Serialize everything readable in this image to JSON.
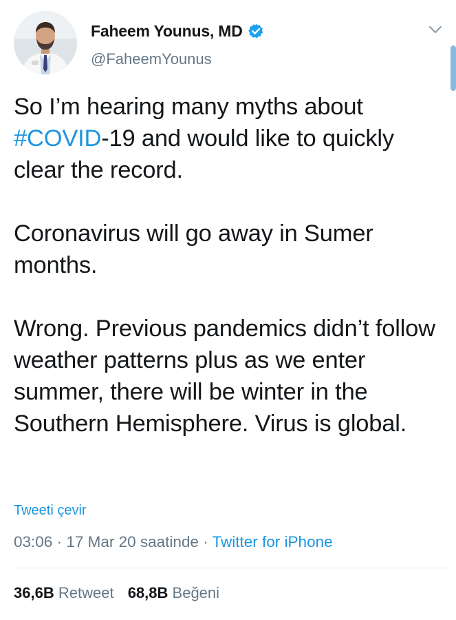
{
  "user": {
    "display_name": "Faheem Younus, MD",
    "handle": "@FaheemYounus",
    "verified": true,
    "avatar_icon": "profile-photo"
  },
  "tweet": {
    "p1_a": "So I’m hearing many myths about",
    "p1_hashtag": "#COVID",
    "p1_b": "-19 and would like to quickly clear the record.",
    "p2": "Coronavirus will go away in Sumer months.",
    "p3": "Wrong. Previous pandemics didn’t follow weather patterns plus as we enter summer, there will be winter in the Southern Hemisphere. Virus is global."
  },
  "translate_label": "Tweeti çevir",
  "meta": {
    "time": "03:06",
    "sep1": " · ",
    "date": "17 Mar 20 saatinde",
    "sep2": " · ",
    "source": "Twitter for iPhone"
  },
  "stats": {
    "retweets_count": "36,6B",
    "retweets_label": "Retweet",
    "likes_count": "68,8B",
    "likes_label": "Beğeni"
  },
  "colors": {
    "link": "#1b95e0",
    "secondary_text": "#657786",
    "primary_text": "#14171a",
    "divider": "#e1e8ed"
  }
}
